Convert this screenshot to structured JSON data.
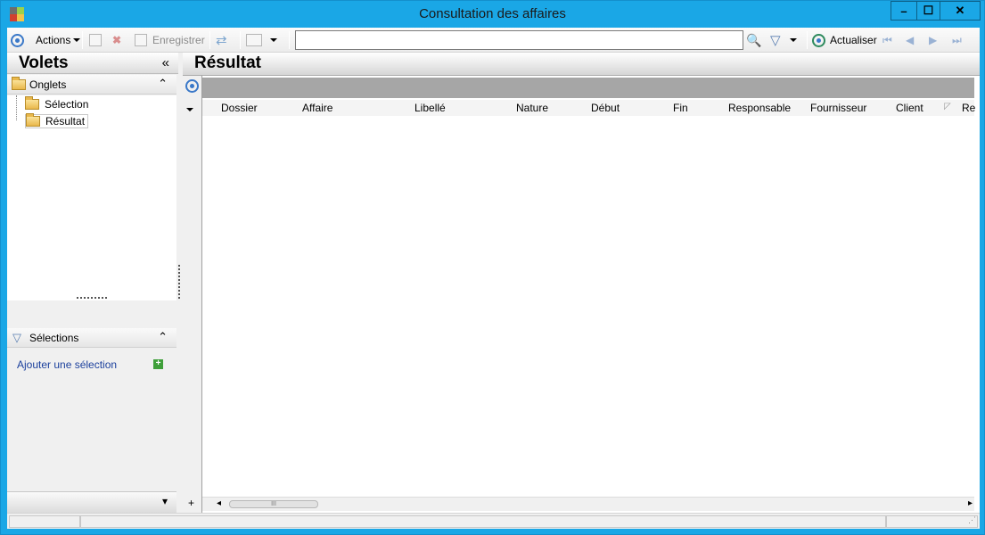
{
  "window": {
    "title": "Consultation des affaires",
    "minimize_glyph": "–",
    "maximize_glyph": "☐",
    "close_glyph": "✕"
  },
  "toolbar": {
    "actions_label": "Actions",
    "save_label": "Enregistrer",
    "search_value": "",
    "refresh_label": "Actualiser"
  },
  "left_panel": {
    "title": "Volets",
    "collapse_glyph": "«",
    "tabs_section": {
      "title": "Onglets",
      "collapse_glyph": "⌃",
      "items": [
        {
          "label": "Sélection",
          "selected": false
        },
        {
          "label": "Résultat",
          "selected": true
        }
      ]
    },
    "selections_section": {
      "title": "Sélections",
      "collapse_glyph": "⌃",
      "add_link": "Ajouter une sélection"
    },
    "bottom_glyph": "▾"
  },
  "main": {
    "title": "Résultat",
    "group_hint": "",
    "columns": [
      "Dossier",
      "Affaire",
      "Libellé",
      "Nature",
      "Début",
      "Fin",
      "Responsable",
      "Fournisseur",
      "Client",
      "Re"
    ],
    "rows": [],
    "add_row_glyph": "+",
    "scroll_thumb": "III"
  },
  "colors": {
    "titlebar": "#1aa7e6",
    "accent_icon": "#3a78c8",
    "link": "#1a3f9c",
    "group_bar": "#a6a6a6"
  }
}
